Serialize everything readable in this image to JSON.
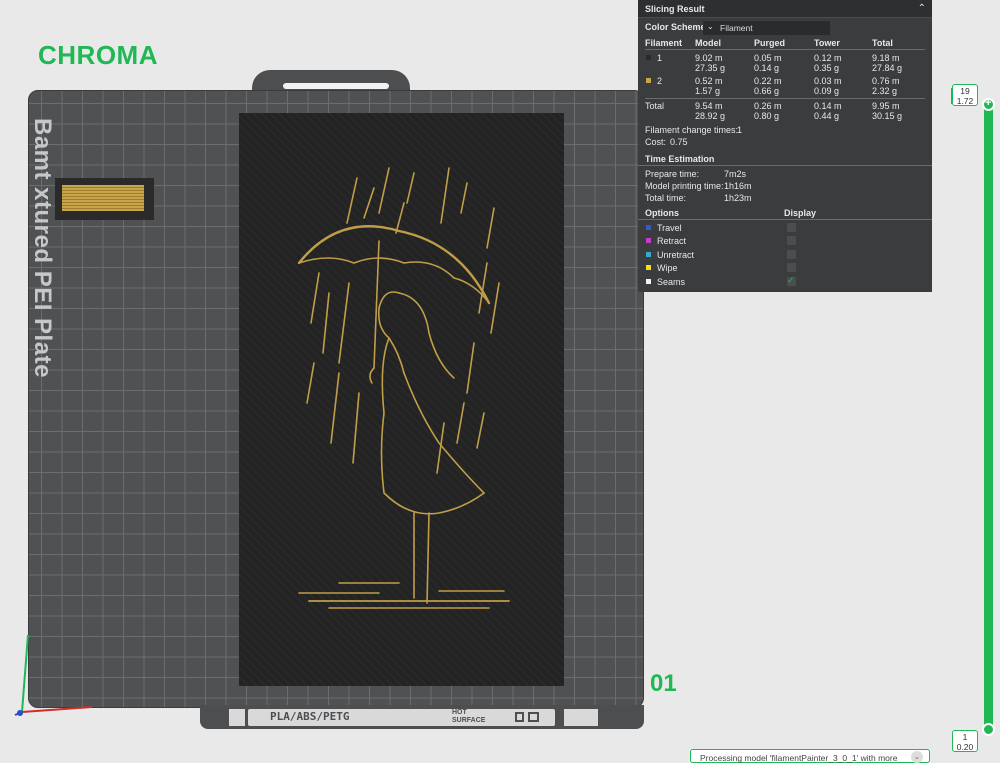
{
  "brand": {
    "title": "CHROMA"
  },
  "plate": {
    "label": "Bambu Textured PEI Plate",
    "visible_label": "Bamt xtured PEI Plate",
    "id": "01",
    "strip_label": "PLA/ABS/PETG",
    "hot_surface": "HOT SURFACE"
  },
  "panel": {
    "title": "Slicing Result",
    "color_scheme_label": "Color Scheme",
    "color_scheme_value": "Filament",
    "columns": [
      "Filament",
      "Model",
      "Purged",
      "Tower",
      "Total"
    ],
    "rows": [
      {
        "id": "1",
        "color": "#2a2a2a",
        "model": [
          "9.02 m",
          "27.35 g"
        ],
        "purged": [
          "0.05 m",
          "0.14 g"
        ],
        "tower": [
          "0.12 m",
          "0.35 g"
        ],
        "total": [
          "9.18 m",
          "27.84 g"
        ]
      },
      {
        "id": "2",
        "color": "#c9a54a",
        "model": [
          "0.52 m",
          "1.57 g"
        ],
        "purged": [
          "0.22 m",
          "0.66 g"
        ],
        "tower": [
          "0.03 m",
          "0.09 g"
        ],
        "total": [
          "0.76 m",
          "2.32 g"
        ]
      }
    ],
    "total": {
      "label": "Total",
      "model": [
        "9.54 m",
        "28.92 g"
      ],
      "purged": [
        "0.26 m",
        "0.80 g"
      ],
      "tower": [
        "0.14 m",
        "0.44 g"
      ],
      "total": [
        "9.95 m",
        "30.15 g"
      ]
    },
    "filament_change_label": "Filament change times:",
    "filament_change_value": "1",
    "cost_label": "Cost:",
    "cost_value": "0.75",
    "time_title": "Time Estimation",
    "times": [
      {
        "label": "Prepare time:",
        "value": "7m2s"
      },
      {
        "label": "Model printing time:",
        "value": "1h16m"
      },
      {
        "label": "Total time:",
        "value": "1h23m"
      }
    ],
    "options_label": "Options",
    "display_label": "Display",
    "options": [
      {
        "label": "Travel",
        "color": "#3a58c8",
        "checked": false
      },
      {
        "label": "Retract",
        "color": "#c83ac8",
        "checked": false
      },
      {
        "label": "Unretract",
        "color": "#3aaac8",
        "checked": false
      },
      {
        "label": "Wipe",
        "color": "#f0e020",
        "checked": false
      },
      {
        "label": "Seams",
        "color": "#f2f2f2",
        "checked": true
      }
    ]
  },
  "slider": {
    "top_layer": "19",
    "top_height": "1.72",
    "bottom_layer": "1",
    "bottom_height": "0.20"
  },
  "status": {
    "text": "Processing model 'filamentPainter_3_0_1' with more"
  },
  "icons": [
    "collapse-up-icon",
    "chevron-down-icon",
    "axis-gizmo-icon",
    "slider-plus-icon",
    "status-chevron-icon"
  ],
  "colors": {
    "accent": "#1fb855",
    "panel_bg": "#3b3c3e",
    "plate_bg": "#505153",
    "model_gold": "#c9a54a"
  }
}
